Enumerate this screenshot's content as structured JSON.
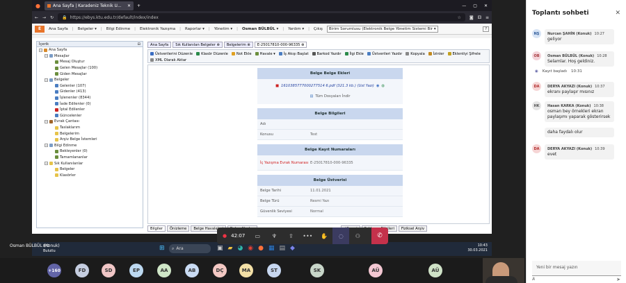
{
  "browser": {
    "tab_title": "Ana Sayfa | Karadeniz Teknik Ü...",
    "url": "https://ebys.ktu.edu.tr/default/index/index"
  },
  "appmenu": {
    "items": [
      "Ana Sayfa",
      "Belgeler ▾",
      "Bilgi Edinme",
      "Elektronik Yazışma",
      "Raporlar ▾",
      "Yönetim ▾"
    ],
    "user": "Osman BÜLBÜL ▾",
    "help_label": "Yardım ▾",
    "logout_label": "Çıkış",
    "role_select": "Birim Sorumlusu (Elektronik Belge Yönetim Sistemi Bir ▾",
    "help_button": "?"
  },
  "tree": {
    "header": "İçerik",
    "nodes": [
      {
        "label": "Ana Sayfa",
        "level": 0,
        "color": "#d88a2b"
      },
      {
        "label": "Mesajlar",
        "level": 1,
        "color": "#7a9cc6"
      },
      {
        "label": "Mesaj Oluştur",
        "level": 2,
        "color": "#6b8e3d"
      },
      {
        "label": "Gelen Mesajlar (100)",
        "level": 2,
        "color": "#6b8e3d"
      },
      {
        "label": "Giden Mesajlar",
        "level": 2,
        "color": "#6b8e3d"
      },
      {
        "label": "Belgeler",
        "level": 1,
        "color": "#7a9cc6"
      },
      {
        "label": "Gelenler (107)",
        "level": 2,
        "color": "#4a7dc1"
      },
      {
        "label": "Gidenler (413)",
        "level": 2,
        "color": "#4a7dc1"
      },
      {
        "label": "İşlenenler (8344)",
        "level": 2,
        "color": "#4a7dc1"
      },
      {
        "label": "İade Edilenler (0)",
        "level": 2,
        "color": "#4a7dc1"
      },
      {
        "label": "İptal Edilenler",
        "level": 2,
        "color": "#c22"
      },
      {
        "label": "Güncelenler",
        "level": 2,
        "color": "#4a7dc1"
      },
      {
        "label": "Evrak Çantası",
        "level": 1,
        "color": "#a0652a"
      },
      {
        "label": "Taslaklarım",
        "level": 2,
        "color": "#e6c34a"
      },
      {
        "label": "Belgelerim",
        "level": 2,
        "color": "#e6c34a"
      },
      {
        "label": "Arşiv Belge İstemleri",
        "level": 2,
        "color": "#e6c34a"
      },
      {
        "label": "Bilgi Edinme",
        "level": 1,
        "color": "#7a9cc6"
      },
      {
        "label": "Bekleyenler (0)",
        "level": 2,
        "color": "#6b8e3d"
      },
      {
        "label": "Tamamlananlar",
        "level": 2,
        "color": "#6b8e3d"
      },
      {
        "label": "Sık Kullanılanlar",
        "level": 1,
        "color": "#e6c34a"
      },
      {
        "label": "Belgeler",
        "level": 2,
        "color": "#e6c34a"
      },
      {
        "label": "Klasörler",
        "level": 2,
        "color": "#e6c34a"
      }
    ]
  },
  "doctabs": [
    "Ana Sayfa",
    "Sık Kullanılan Belgeler ⊗",
    "Belgelerim ⊗",
    "E-25017810-000-96335 ⊗"
  ],
  "toolbar": [
    "Üstverilerini Düzenle",
    "Klasör Düzenle",
    "Not Ekle",
    "Havale ▾",
    "İş Akışı Başlat",
    "Barkod Yazdır",
    "İlgi Ekle",
    "Üstverileri Yazdır",
    "Kopyala",
    "İzinler",
    "Eklentiyi Şifrele",
    "XML Olarak Aktar"
  ],
  "panel": {
    "ekler_title": "Belge Belge Ekleri",
    "attachment": "1610385777000277514 6.pdf (321.3 kb.) (Ust Yazı)",
    "download_all": "Tüm Dosyaları İndir",
    "bilgi_title": "Belge Bilgileri",
    "bilgi_rows": [
      {
        "k": "Adı",
        "v": ""
      },
      {
        "k": "Konusu",
        "v": "Test"
      }
    ],
    "kayit_title": "Belge Kayıt Numaraları",
    "kayit_rows": [
      {
        "k": "İç Yazışma Evrak Numarası",
        "v": "E-25017810-000-96335"
      }
    ],
    "ust_title": "Belge Üstverisi",
    "ust_rows": [
      {
        "k": "Belge Tarihi",
        "v": "11.01.2021"
      },
      {
        "k": "Belge Türü",
        "v": "Resmi Yazı"
      },
      {
        "k": "Güvenlik Seviyesi",
        "v": "Normal"
      }
    ]
  },
  "bottomtabs": [
    "Bilgiler",
    "Önizleme",
    "Belge Havaleleri",
    "Belge Akışları",
    "",
    "",
    "",
    "rtfhçesi",
    "Saklama Bilgileri",
    "Fiziksel Arşiv"
  ],
  "meeting": {
    "timer": "42:07"
  },
  "taskbar": {
    "weather_temp": "8°C",
    "weather_label": "Bulutlu",
    "search_label": "Ara",
    "time": "10:43",
    "date": "30.03.2021"
  },
  "presenter_label": "Osman BÜLBÜL (Konuk)",
  "participants": [
    {
      "initials": "+160",
      "color": "#6264a7"
    },
    {
      "initials": "FD",
      "color": "#c5cde0"
    },
    {
      "initials": "SD",
      "color": "#f0c6c6"
    },
    {
      "initials": "EP",
      "color": "#bcd8f0"
    },
    {
      "initials": "AA",
      "color": "#cfe6c7"
    },
    {
      "initials": "AB",
      "color": "#c9dbf3"
    },
    {
      "initials": "DÇ",
      "color": "#f3c8c3"
    },
    {
      "initials": "MA",
      "color": "#f3e0a6"
    },
    {
      "initials": "ST",
      "color": "#c7d7f0"
    },
    {
      "initials": "SK",
      "color": "#c8d6c9"
    },
    {
      "initials": "AÜ",
      "color": "#f3c7d2"
    },
    {
      "initials": "AÜ",
      "color": "#cfe2c7"
    }
  ],
  "chat": {
    "title": "Toplantı sohbeti",
    "messages": [
      {
        "initials": "NŞ",
        "av_color": "#d7e4f5",
        "av_text": "#2b5797",
        "author": "Nurcan ŞAHİN (Konuk)",
        "time": "10:27",
        "text": "geliyor"
      },
      {
        "initials": "OB",
        "av_color": "#f3d3d9",
        "av_text": "#a4373a",
        "author": "Osman BÜLBÜL (Konuk)",
        "time": "10:28",
        "text": "Selamlar. Hoş geldiniz."
      },
      {
        "initials": "DA",
        "av_color": "#f6d5d5",
        "av_text": "#b02a2a",
        "author": "DERYA AKYAZI (Konuk)",
        "time": "10:37",
        "text": "ekranı paylaşır mısınız"
      },
      {
        "initials": "HK",
        "av_color": "#e5e5e5",
        "av_text": "#555",
        "author": "Hasan KARKA (Konuk)",
        "time": "10:38",
        "text": "osman bey örnekleri ekran paylaşımı yaparak gösterirsek"
      },
      {
        "initials": "",
        "av_color": "#fff",
        "av_text": "#555",
        "author": "",
        "time": "",
        "text": "daha faydalı olur"
      },
      {
        "initials": "DA",
        "av_color": "#f6d5d5",
        "av_text": "#b02a2a",
        "author": "DERYA AKYAZI (Konuk)",
        "time": "10:39",
        "text": "evet"
      }
    ],
    "system_text": "Kayıt başladı",
    "system_time": "10:31",
    "input_placeholder": "Yeni bir mesaj yazın"
  }
}
